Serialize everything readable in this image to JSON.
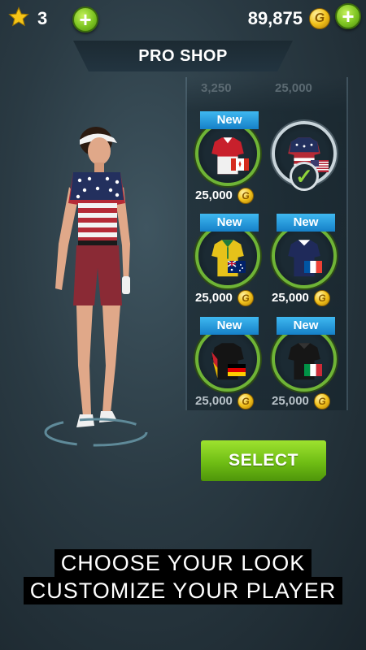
{
  "header": {
    "star_count": "3",
    "coin_total": "89,875",
    "coin_symbol": "G",
    "plus_symbol": "+"
  },
  "shop": {
    "title": "PRO SHOP"
  },
  "ghost_prices": [
    "3,250",
    "25,000"
  ],
  "items": [
    {
      "badge": "New",
      "price": "25,000",
      "flag": "Canada",
      "shirt": "canada-red-white",
      "selected": false
    },
    {
      "badge": "",
      "price": "",
      "flag": "USA",
      "shirt": "usa-stars-stripes",
      "selected": true
    },
    {
      "badge": "New",
      "price": "25,000",
      "flag": "Australia",
      "shirt": "australia-gold-green",
      "selected": false
    },
    {
      "badge": "New",
      "price": "25,000",
      "flag": "France",
      "shirt": "france-navy",
      "selected": false
    },
    {
      "badge": "New",
      "price": "25,000",
      "flag": "Germany",
      "shirt": "germany-black-red-gold",
      "selected": false
    },
    {
      "badge": "New",
      "price": "25,000",
      "flag": "Italy",
      "shirt": "italy-black",
      "selected": false
    }
  ],
  "select_button": "SELECT",
  "tagline": {
    "line1": "CHOOSE YOUR LOOK",
    "line2": "CUSTOMIZE YOUR PLAYER"
  },
  "colors": {
    "accent_green": "#7cc321",
    "badge_blue": "#1a8fd6",
    "coin_gold": "#f2c21b"
  }
}
